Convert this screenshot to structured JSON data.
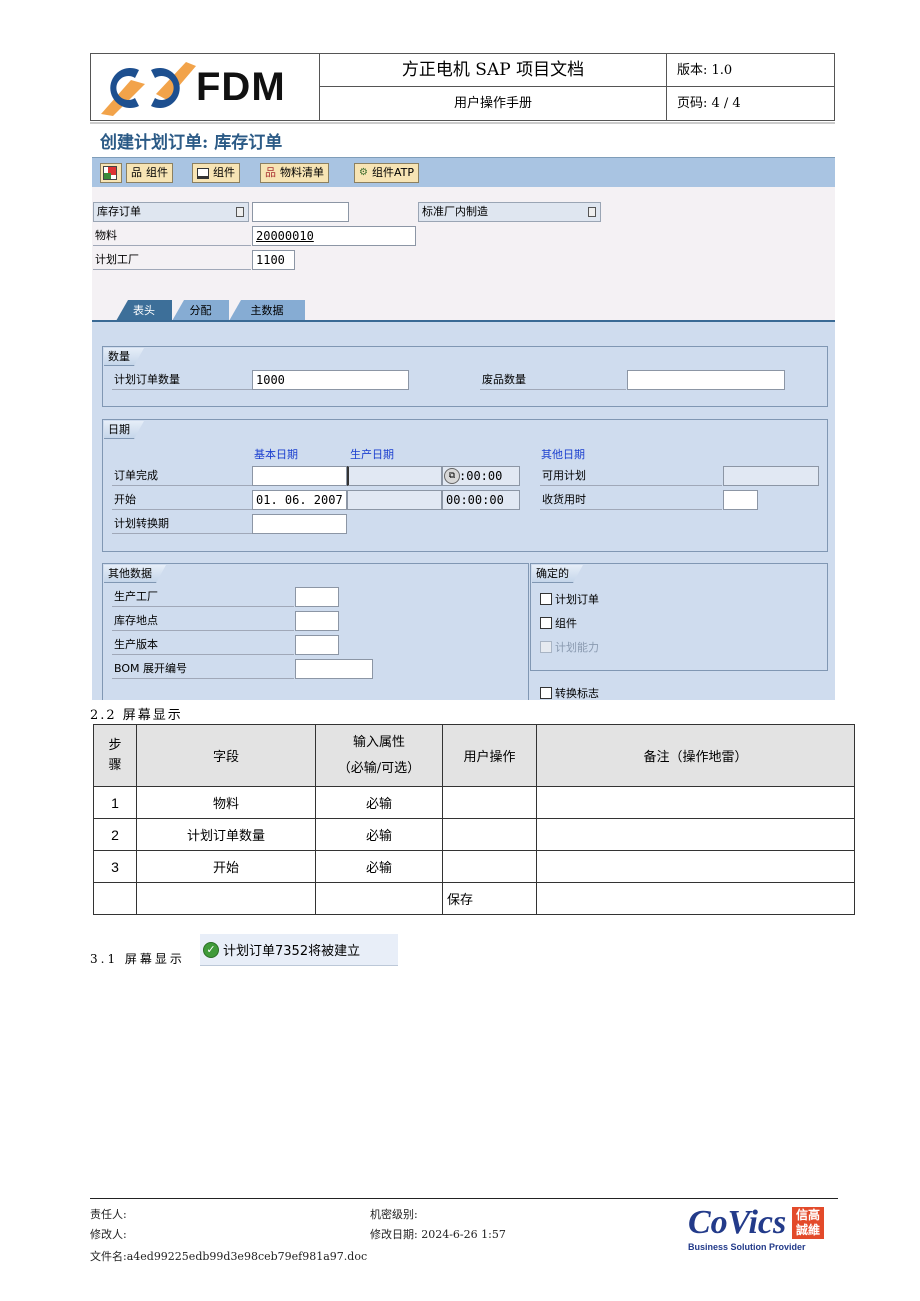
{
  "header": {
    "logo_text": "FDM",
    "doc_title": "方正电机 SAP 项目文档",
    "doc_subtitle": "用户操作手册",
    "version": "版本: 1.0",
    "page": "页码: 4 / 4"
  },
  "sap": {
    "title": "创建计划订单: 库存订单",
    "toolbar": [
      {
        "icon": "document-popup-icon",
        "label": ""
      },
      {
        "icon": "hierarchy-icon",
        "label": "组件"
      },
      {
        "icon": "printer-icon",
        "label": "组件"
      },
      {
        "icon": "hierarchy-icon",
        "label": "物料清单"
      },
      {
        "icon": "atp-check-icon",
        "label": "组件ATP"
      }
    ],
    "order_type": {
      "label": "库存订单",
      "value": ""
    },
    "procurement": {
      "label": "标准厂内制造"
    },
    "material": {
      "label": "物料",
      "value": "20000010"
    },
    "plant": {
      "label": "计划工厂",
      "value": "1100"
    },
    "tabs": [
      {
        "label": "表头",
        "active": true
      },
      {
        "label": "分配",
        "active": false
      },
      {
        "label": "主数据",
        "active": false
      }
    ],
    "quantity_group": {
      "title": "数量",
      "order_qty": {
        "label": "计划订单数量",
        "value": "1000"
      },
      "scrap_qty": {
        "label": "废品数量",
        "value": ""
      }
    },
    "dates_group": {
      "title": "日期",
      "col_basic": "基本日期",
      "col_production": "生产日期",
      "col_other": "其他日期",
      "finish": {
        "label": "订单完成",
        "basic": "",
        "production": "",
        "time": ":00:00"
      },
      "start": {
        "label": "开始",
        "basic": "01. 06. 2007",
        "production": "",
        "time": "00:00:00"
      },
      "conversion": {
        "label": "计划转换期",
        "value": ""
      },
      "availability": {
        "label": "可用计划",
        "value": ""
      },
      "gr_time": {
        "label": "收货用时",
        "value": ""
      }
    },
    "other_group": {
      "title": "其他数据",
      "prod_plant": {
        "label": "生产工厂",
        "value": ""
      },
      "storage_loc": {
        "label": "库存地点",
        "value": ""
      },
      "prod_version": {
        "label": "生产版本",
        "value": ""
      },
      "bom_explosion": {
        "label": "BOM 展开编号",
        "value": ""
      }
    },
    "firmed_group": {
      "title": "确定的",
      "items": [
        {
          "label": "计划订单",
          "checked": false,
          "disabled": false
        },
        {
          "label": "组件",
          "checked": false,
          "disabled": false
        },
        {
          "label": "计划能力",
          "checked": false,
          "disabled": true
        }
      ]
    },
    "conversion_flag": {
      "label": "转换标志",
      "checked": false
    }
  },
  "section_22": "2.2 屏幕显示",
  "steps_table": {
    "headers": [
      "步骤",
      "字段",
      "输入属性\n（必输/可选）",
      "用户操作",
      "备注（操作地雷）"
    ],
    "rows": [
      [
        "1",
        "物料",
        "必输",
        "",
        ""
      ],
      [
        "2",
        "计划订单数量",
        "必输",
        "",
        ""
      ],
      [
        "3",
        "开始",
        "必输",
        "",
        ""
      ],
      [
        "",
        "",
        "",
        "保存",
        ""
      ]
    ]
  },
  "section_31": "3.1 屏幕显示",
  "status_message": "计划订单7352将被建立",
  "footer": {
    "responsible": "责任人:",
    "confidentiality": "机密级别:",
    "modifier": "修改人:",
    "modified_date": "修改日期: 2024-6-26 1:57",
    "filename": "文件名:a4ed99225edb99d3e98ceb79ef981a97.doc",
    "covics_logo": "CoVics",
    "covics_seal": "信高 誠維",
    "covics_tagline": "Business Solution Provider"
  }
}
